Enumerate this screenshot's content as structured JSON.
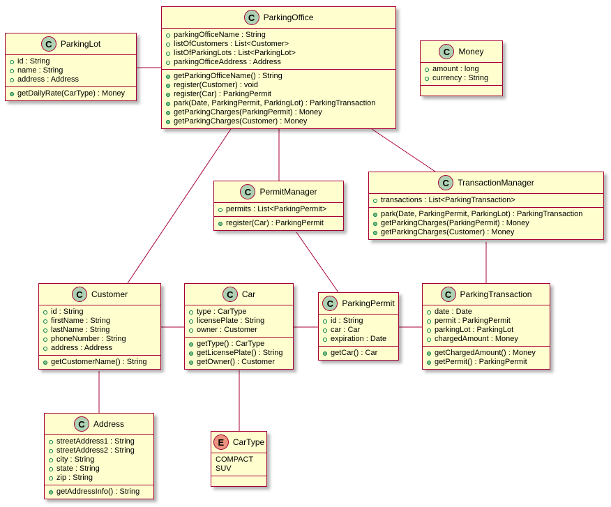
{
  "colors": {
    "fill": "#FEFECE",
    "border": "#A80036",
    "class_badge": "#ADD1B2",
    "enum_badge": "#EB937F",
    "field_marker": "#038048",
    "method_marker": "#84BE84"
  },
  "classes": [
    {
      "id": "ParkingLot",
      "kind": "C",
      "name": "ParkingLot",
      "fields": [
        "id : String",
        "name : String",
        "address : Address"
      ],
      "methods": [
        "getDailyRate(CarType) : Money"
      ]
    },
    {
      "id": "ParkingOffice",
      "kind": "C",
      "name": "ParkingOffice",
      "fields": [
        "parkingOfficeName : String",
        "listOfCustomers : List<Customer>",
        "listOfParkingLots : List<ParkingLot>",
        "parkingOfficeAddress : Address"
      ],
      "methods": [
        "getParkingOfficeName() : String",
        "register(Customer) : void",
        "register(Car) : ParkingPermit",
        "park(Date, ParkingPermit, ParkingLot) : ParkingTransaction",
        "getParkingCharges(ParkingPermit) : Money",
        "getParkingCharges(Customer) : Money"
      ]
    },
    {
      "id": "Money",
      "kind": "C",
      "name": "Money",
      "fields": [
        "amount : long",
        "currency : String"
      ],
      "methods": []
    },
    {
      "id": "PermitManager",
      "kind": "C",
      "name": "PermitManager",
      "fields": [
        "permits : List<ParkingPermit>"
      ],
      "methods": [
        "register(Car) : ParkingPermit"
      ]
    },
    {
      "id": "TransactionManager",
      "kind": "C",
      "name": "TransactionManager",
      "fields": [
        "transactions : List<ParkingTransaction>"
      ],
      "methods": [
        "park(Date, ParkingPermit, ParkingLot) : ParkingTransaction",
        "getParkingCharges(ParkingPermit) : Money",
        "getParkingCharges(Customer) : Money"
      ]
    },
    {
      "id": "Customer",
      "kind": "C",
      "name": "Customer",
      "fields": [
        "id : String",
        "firstName : String",
        "lastName : String",
        "phoneNumber : String",
        "address : Address"
      ],
      "methods": [
        "getCustomerName() : String"
      ]
    },
    {
      "id": "Car",
      "kind": "C",
      "name": "Car",
      "fields": [
        "type : CarType",
        "licensePlate : String",
        "owner : Customer"
      ],
      "methods": [
        "getType() : CarType",
        "getLicensePlate() : String",
        "getOwner() : Customer"
      ]
    },
    {
      "id": "ParkingPermit",
      "kind": "C",
      "name": "ParkingPermit",
      "fields": [
        "id : String",
        "car : Car",
        "expiration : Date"
      ],
      "methods": [
        "getCar() : Car"
      ]
    },
    {
      "id": "ParkingTransaction",
      "kind": "C",
      "name": "ParkingTransaction",
      "fields": [
        "date : Date",
        "permit : ParkingPermit",
        "parkingLot : ParkingLot",
        "chargedAmount : Money"
      ],
      "methods": [
        "getChargedAmount() : Money",
        "getPermit() : ParkingPermit"
      ]
    },
    {
      "id": "Address",
      "kind": "C",
      "name": "Address",
      "fields": [
        "streetAddress1 : String",
        "streetAddress2 : String",
        "city : String",
        "state : String",
        "zip : String"
      ],
      "methods": [
        "getAddressInfo() : String"
      ]
    },
    {
      "id": "CarType",
      "kind": "E",
      "name": "CarType",
      "constants": [
        "COMPACT",
        "SUV"
      ],
      "methods": []
    }
  ],
  "associations": [
    [
      "ParkingLot",
      "ParkingOffice"
    ],
    [
      "ParkingOffice",
      "Customer"
    ],
    [
      "ParkingOffice",
      "PermitManager"
    ],
    [
      "ParkingOffice",
      "TransactionManager"
    ],
    [
      "PermitManager",
      "ParkingPermit"
    ],
    [
      "TransactionManager",
      "ParkingTransaction"
    ],
    [
      "Customer",
      "Car"
    ],
    [
      "Car",
      "ParkingPermit"
    ],
    [
      "ParkingPermit",
      "ParkingTransaction"
    ],
    [
      "Customer",
      "Address"
    ],
    [
      "Car",
      "CarType"
    ]
  ]
}
